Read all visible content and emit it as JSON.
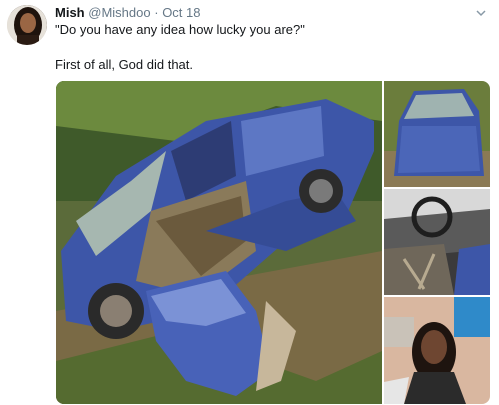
{
  "tweet": {
    "display_name": "Mish",
    "handle": "@Mishdoo",
    "separator": "·",
    "date": "Oct 18",
    "line1": "\"Do you have any idea how lucky you are?\"",
    "line2": "First of all, God did that."
  },
  "icons": {
    "avatar": "profile-photo",
    "caret": "chevron-down-icon"
  },
  "colors": {
    "text": "#14171a",
    "muted": "#657786",
    "car_blue": "#3d56a8"
  }
}
